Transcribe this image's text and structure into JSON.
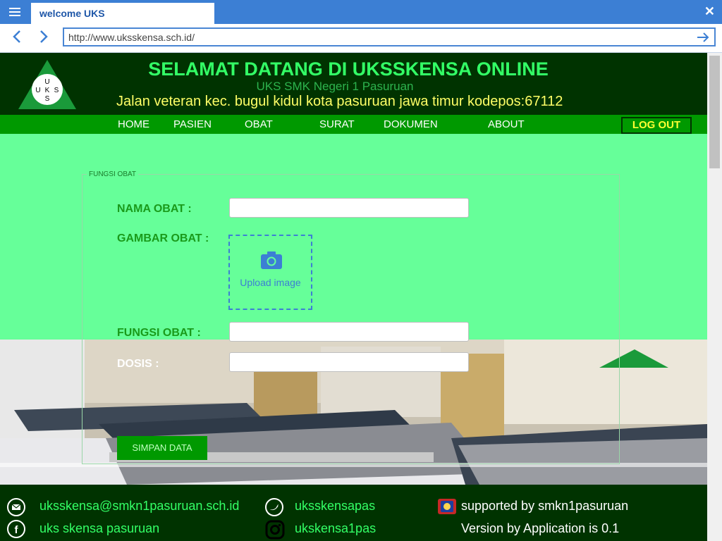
{
  "browser": {
    "tab_title": "welcome UKS",
    "url": "http://www.uksskensa.sch.id/"
  },
  "header": {
    "logo_letters": "U K S",
    "title": "SELAMAT DATANG DI UKSSKENSA ONLINE",
    "subtitle": "UKS SMK Negeri 1 Pasuruan",
    "address": "Jalan veteran kec. bugul kidul kota pasuruan jawa timur kodepos:67112"
  },
  "menu": {
    "home": "HOME",
    "pasien": "PASIEN",
    "obat": "OBAT",
    "surat": "SURAT",
    "dokumen": "DOKUMEN",
    "about": "ABOUT",
    "logout": "LOG OUT"
  },
  "form": {
    "legend": "FUNGSI OBAT",
    "nama_label": "NAMA OBAT :",
    "nama_value": "",
    "gambar_label": "GAMBAR OBAT :",
    "upload_label": "Upload image",
    "fungsi_label": "FUNGSI OBAT :",
    "fungsi_value": "",
    "dosis_label": "DOSIS :",
    "dosis_value": "",
    "submit_label": "SIMPAN DATA"
  },
  "footer": {
    "email": "uksskensa@smkn1pasuruan.sch.id",
    "facebook": "uks skensa pasuruan",
    "twitter": "uksskensapas",
    "instagram": "ukskensa1pas",
    "supported": "supported by smkn1pasuruan",
    "version": "Version by Application is 0.1"
  },
  "colors": {
    "page_bg": "#66ff99",
    "header_bg": "#003300",
    "menu_bg": "#009900",
    "title": "#33ff66",
    "address": "#ffff66",
    "browser_accent": "#3c7fd4"
  },
  "icons": [
    "hamburger-icon",
    "close-icon",
    "back-arrow-icon",
    "forward-arrow-icon",
    "go-arrow-icon",
    "camera-icon",
    "mail-icon",
    "facebook-icon",
    "twitter-icon",
    "instagram-icon",
    "school-emblem-icon"
  ]
}
